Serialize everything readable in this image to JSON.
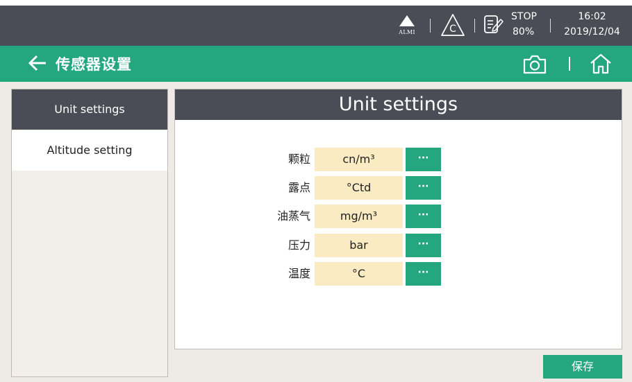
{
  "status_bar": {
    "alarm_icon": "alarm-triangle-icon",
    "alarm_text": "ALMI",
    "calibration_icon": "calibration-c-icon",
    "recorder_icon": "recorder-edit-icon",
    "recorder_status": "STOP",
    "recorder_percent": "80%",
    "time": "16:02",
    "date": "2019/12/04"
  },
  "title_bar": {
    "back_icon": "back-arrow-icon",
    "title": "传感器设置",
    "camera_icon": "camera-icon",
    "home_icon": "home-icon"
  },
  "sidebar": {
    "items": [
      {
        "label": "Unit settings",
        "active": true
      },
      {
        "label": "Altitude setting",
        "active": false
      }
    ]
  },
  "panel": {
    "title": "Unit settings",
    "rows": [
      {
        "label": "颗粒",
        "value": "cn/m³",
        "button": "···"
      },
      {
        "label": "露点",
        "value": "°Ctd",
        "button": "···"
      },
      {
        "label": "油蒸气",
        "value": "mg/m³",
        "button": "···"
      },
      {
        "label": "压力",
        "value": "bar",
        "button": "···"
      },
      {
        "label": "温度",
        "value": "°C",
        "button": "···"
      }
    ]
  },
  "footer": {
    "save_label": "保存"
  },
  "colors": {
    "header_dark": "#4a4d55",
    "accent_green": "#24a77e",
    "value_bg": "#faebc3",
    "page_bg": "#eeebe6"
  }
}
